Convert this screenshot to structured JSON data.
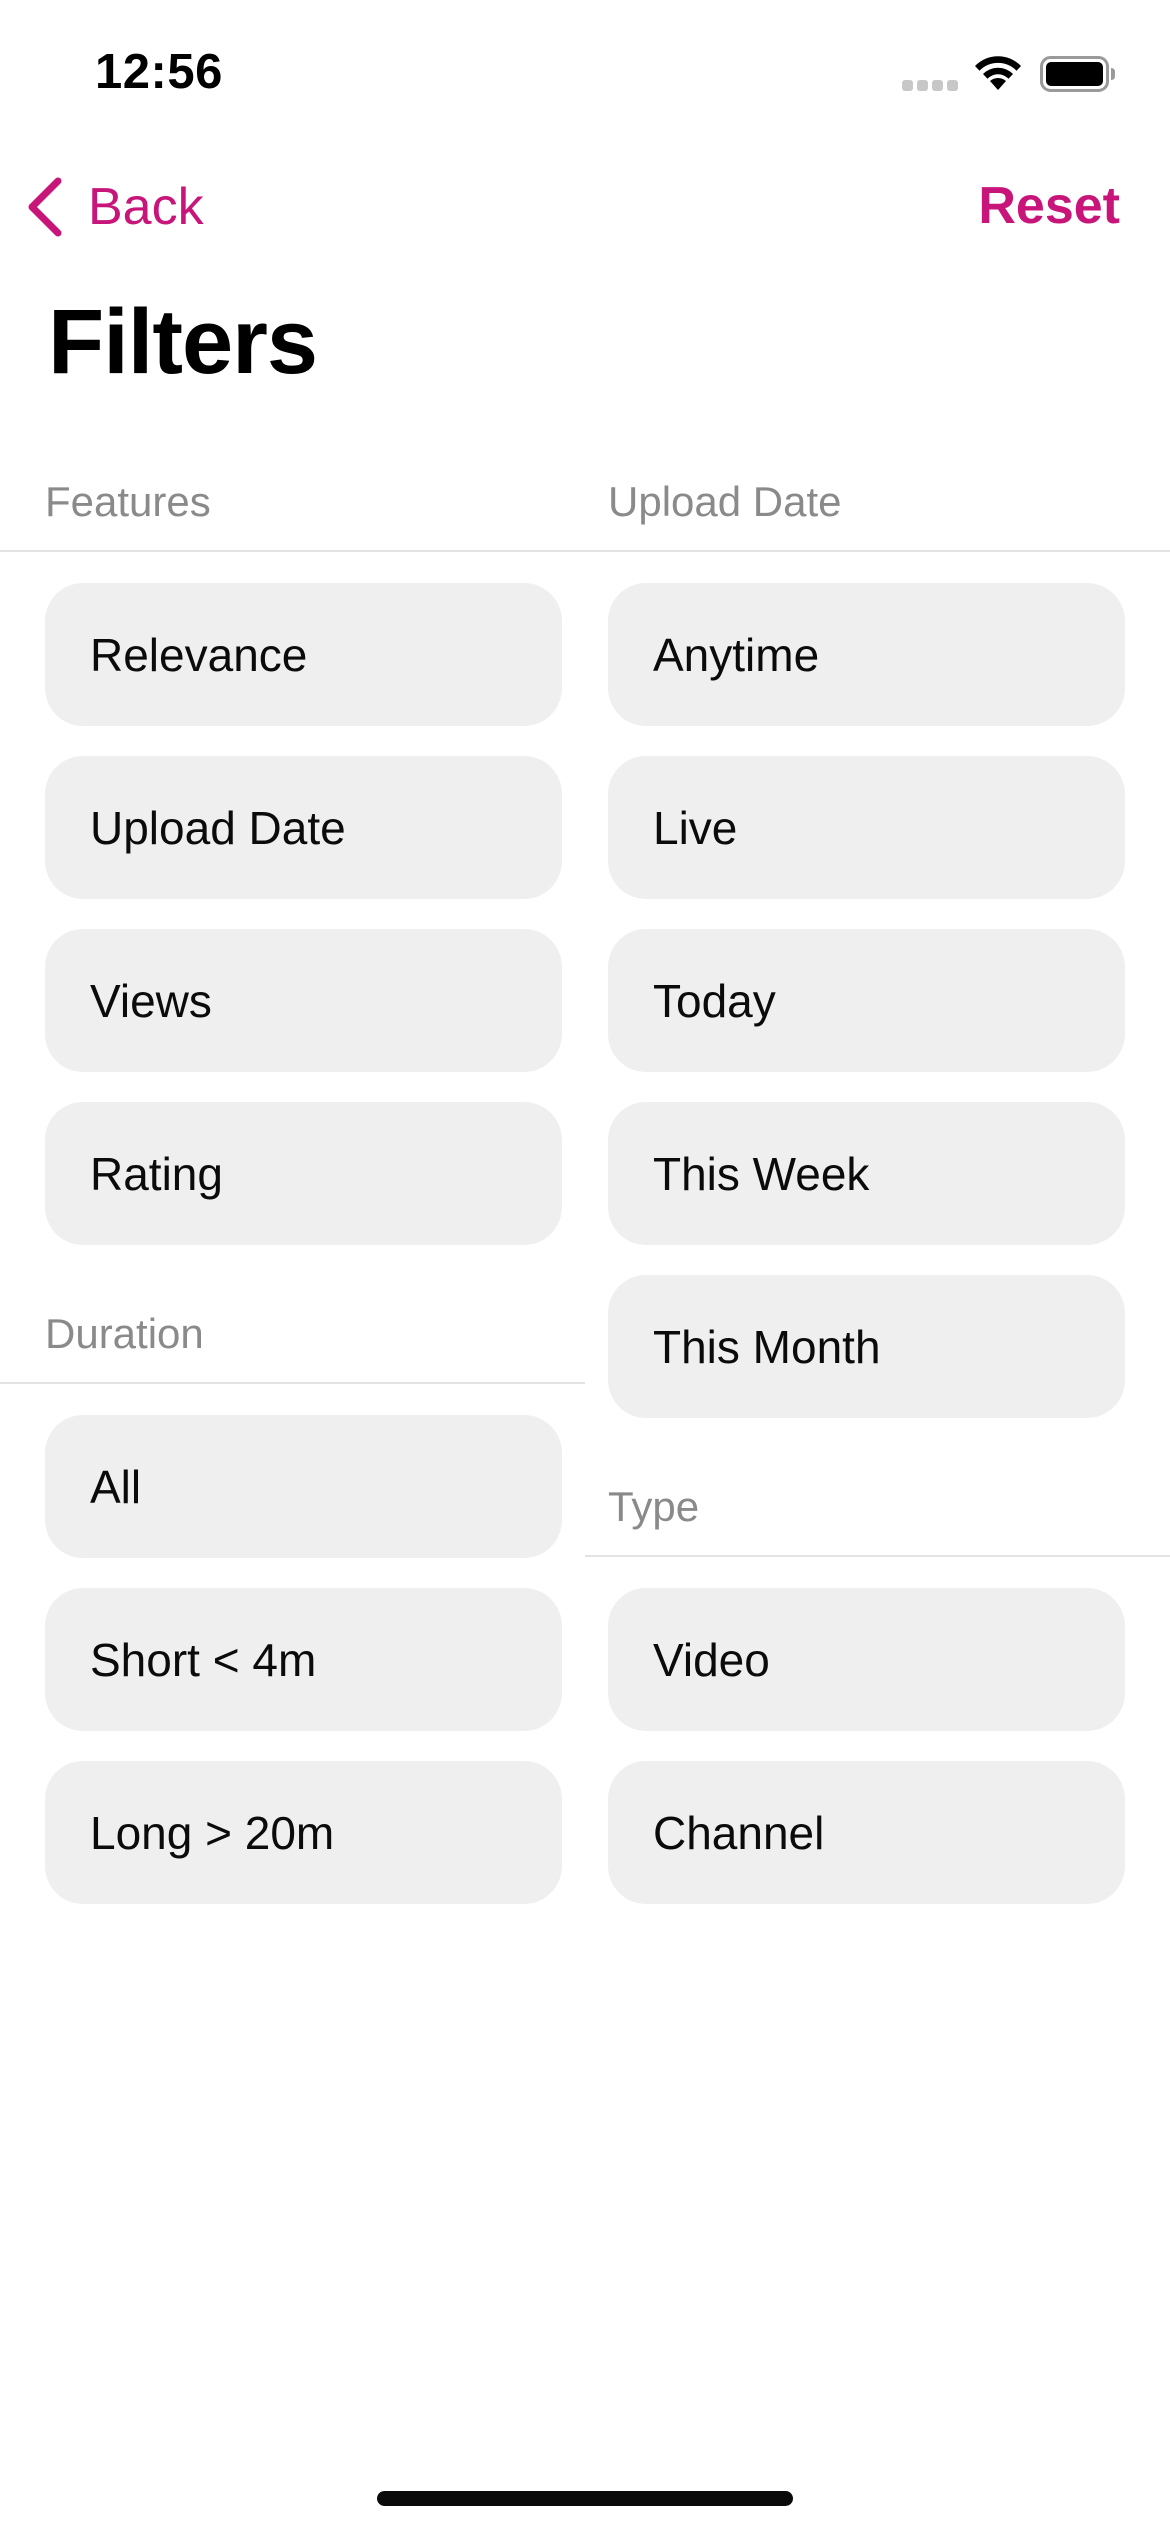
{
  "status_bar": {
    "time": "12:56"
  },
  "nav": {
    "back_label": "Back",
    "reset_label": "Reset",
    "accent_color": "#c8157a"
  },
  "page": {
    "title": "Filters"
  },
  "columns": {
    "left": [
      {
        "title": "Features",
        "options": [
          "Relevance",
          "Upload Date",
          "Views",
          "Rating"
        ]
      },
      {
        "title": "Duration",
        "options": [
          "All",
          "Short < 4m",
          "Long > 20m"
        ]
      }
    ],
    "right": [
      {
        "title": "Upload Date",
        "options": [
          "Anytime",
          "Live",
          "Today",
          "This Week",
          "This Month"
        ]
      },
      {
        "title": "Type",
        "options": [
          "Video",
          "Channel"
        ]
      }
    ]
  },
  "icons": {
    "back": "chevron-left-icon",
    "wifi": "wifi-icon",
    "battery": "battery-icon",
    "signal": "cell-signal-icon"
  }
}
